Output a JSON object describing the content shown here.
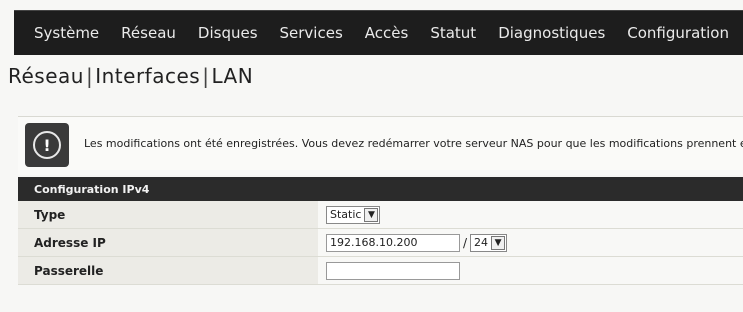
{
  "nav": {
    "items": [
      "Système",
      "Réseau",
      "Disques",
      "Services",
      "Accès",
      "Statut",
      "Diagnostiques",
      "Configuration"
    ]
  },
  "breadcrumb": {
    "parts": [
      "Réseau",
      "Interfaces",
      "LAN"
    ]
  },
  "message": {
    "text": "Les modifications ont été enregistrées. Vous devez redémarrer votre serveur NAS pour que les modifications prennent eff",
    "icon": "warning-icon"
  },
  "form": {
    "section_title": "Configuration IPv4",
    "type_label": "Type",
    "type_value": "Static",
    "ip_label": "Adresse IP",
    "ip_value": "192.168.10.200",
    "ip_separator": "/",
    "mask_value": "24",
    "gateway_label": "Passerelle",
    "gateway_value": ""
  }
}
